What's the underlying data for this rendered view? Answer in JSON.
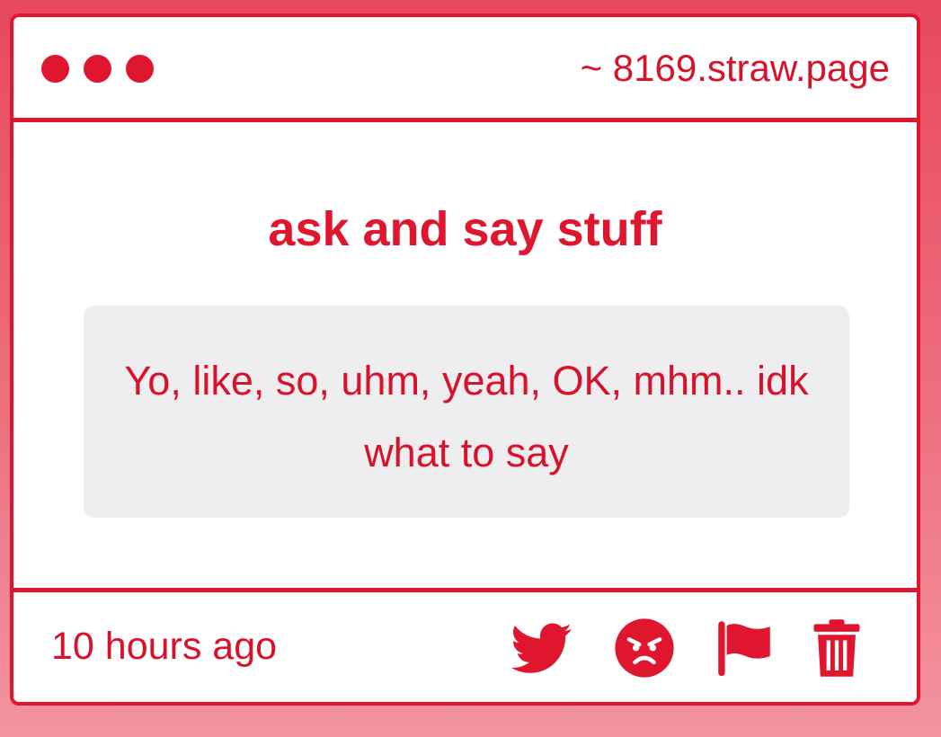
{
  "window": {
    "url": "~ 8169.straw.page"
  },
  "post": {
    "title": "ask and say stuff",
    "message": "Yo, like, so, uhm, yeah, OK, mhm.. idk what to say"
  },
  "footer": {
    "timestamp": "10 hours ago",
    "actions": [
      {
        "icon": "twitter-icon"
      },
      {
        "icon": "angry-face-icon"
      },
      {
        "icon": "flag-icon"
      },
      {
        "icon": "trash-icon"
      }
    ]
  },
  "colors": {
    "accent": "#e0162f",
    "background_top": "#e8485e",
    "background_bottom": "#f3949e",
    "message_box": "#eeedef",
    "card": "#ffffff"
  }
}
